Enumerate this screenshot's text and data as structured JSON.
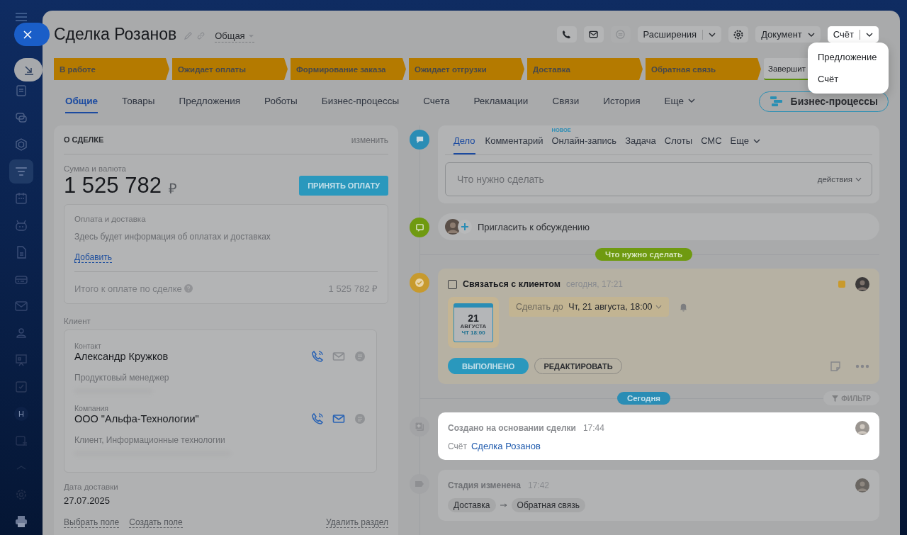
{
  "sidebar": {
    "avatar_letter": "Н"
  },
  "deal": {
    "title": "Сделка Розанов",
    "category": "Общая"
  },
  "toolbar": {
    "extensions": "Расширения",
    "document": "Документ",
    "invoice": {
      "label": "Счёт",
      "expanded": true
    }
  },
  "menu": {
    "items": [
      "Предложение",
      "Счёт"
    ]
  },
  "stages": [
    {
      "label": "В работе",
      "kind": "active"
    },
    {
      "label": "Ожидает оплаты",
      "kind": "active"
    },
    {
      "label": "Формирование заказа",
      "kind": "active"
    },
    {
      "label": "Ожидает отгрузки",
      "kind": "active"
    },
    {
      "label": "Доставка",
      "kind": "active"
    },
    {
      "label": "Обратная связь",
      "kind": "active"
    },
    {
      "label": "Завершит",
      "kind": "final"
    }
  ],
  "tabs": [
    {
      "label": "Общие",
      "selected": true
    },
    {
      "label": "Товары",
      "selected": false
    },
    {
      "label": "Предложения",
      "selected": false
    },
    {
      "label": "Роботы",
      "selected": false
    },
    {
      "label": "Бизнес-процессы",
      "selected": false
    },
    {
      "label": "Счета",
      "selected": false
    },
    {
      "label": "Рекламации",
      "selected": false
    },
    {
      "label": "Связи",
      "selected": false
    },
    {
      "label": "История",
      "selected": false
    },
    {
      "label": "Еще",
      "selected": false
    }
  ],
  "business_button": "Бизнес-процессы",
  "about": {
    "title": "О СДЕЛКЕ",
    "edit": "изменить",
    "amount_label": "Сумма и валюта",
    "amount": "1 525 782",
    "currency": "₽",
    "pay_button": "ПРИНЯТЬ ОПЛАТУ",
    "payment": {
      "title": "Оплата и доставка",
      "text": "Здесь будет информация об оплатах и доставках",
      "add": "Добавить",
      "total_label": "Итого к оплате по сделке",
      "total": "1 525 782 ₽"
    },
    "client_label": "Клиент",
    "contacts": [
      {
        "type_label": "Контакт",
        "name": "Александр Кружков",
        "subtitle": "Продуктовый менеджер",
        "email_active": false
      },
      {
        "type_label": "Компания",
        "name": "ООО \"Альфа-Технологии\"",
        "subtitle": "Клиент, Информационные технологии",
        "email_active": true
      }
    ],
    "delivery_label": "Дата доставки",
    "delivery_date": "27.07.2025",
    "links": [
      "Выбрать поле",
      "Создать поле"
    ],
    "delete": "Удалить раздел"
  },
  "composer": {
    "tabs": [
      {
        "label": "Дело",
        "selected": true
      },
      {
        "label": "Комментарий",
        "selected": false
      },
      {
        "label": "Онлайн-запись",
        "selected": false,
        "badge": "НОВОЕ"
      },
      {
        "label": "Задача",
        "selected": false
      },
      {
        "label": "Слоты",
        "selected": false
      },
      {
        "label": "СМС",
        "selected": false
      },
      {
        "label": "Еще",
        "selected": false
      }
    ],
    "placeholder": "Что нужно сделать",
    "actions": "действия"
  },
  "invite": "Пригласить к обсуждению",
  "todo_divider": "Что нужно сделать",
  "task": {
    "checked": false,
    "title": "Связаться с клиентом",
    "time": "сегодня, 17:21",
    "calendar": {
      "day": "21",
      "month": "АВГУСТА",
      "time": "ЧТ 18:00"
    },
    "deadline_prefix": "Сделать до",
    "deadline": "Чт, 21 августа, 18:00",
    "done_button": "ВЫПОЛНЕНО",
    "edit_button": "РЕДАКТИРОВАТЬ"
  },
  "today_divider": "Сегодня",
  "filter": "ФИЛЬТР",
  "history": [
    {
      "kind": "created",
      "highlighted": true,
      "title": "Создано на основании сделки",
      "time": "17:44",
      "doc_type": "Счёт",
      "link": "Сделка Розанов"
    },
    {
      "kind": "stage",
      "highlighted": false,
      "title": "Стадия изменена",
      "time": "17:42",
      "from": "Доставка",
      "to": "Обратная связь"
    }
  ]
}
